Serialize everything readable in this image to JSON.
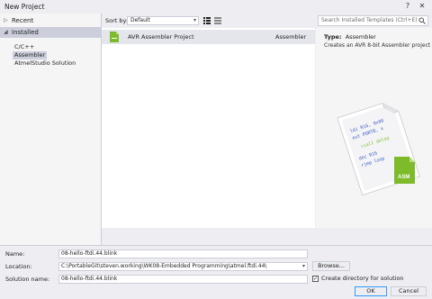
{
  "window": {
    "title": "New Project",
    "help_label": "?",
    "close_label": "✕"
  },
  "sidebar": {
    "recent_label": "Recent",
    "installed_label": "Installed",
    "items": [
      {
        "label": "C/C++"
      },
      {
        "label": "Assembler"
      },
      {
        "label": "AtmelStudio Solution"
      }
    ]
  },
  "toolbar": {
    "sort_label": "Sort by:",
    "sort_value": "Default"
  },
  "templates": [
    {
      "name": "AVR Assembler Project",
      "language": "Assembler"
    }
  ],
  "search": {
    "placeholder": "Search Installed Templates (Ctrl+E)"
  },
  "details": {
    "type_label": "Type:",
    "type_value": "Assembler",
    "description": "Creates an AVR 8-bit Assembler project"
  },
  "preview": {
    "code_lines": [
      "ldi R16, 0x00",
      "out PORTB, x",
      "rcall delay",
      "dec R16",
      "rjmp loop"
    ],
    "badge": "ASM"
  },
  "form": {
    "name_label": "Name:",
    "name_value": "08-hello-ftdi.44.blink",
    "location_label": "Location:",
    "location_value": "C:\\PortableGit\\steven.working\\WK08-Embedded Programming\\atmel.ftdi.44\\",
    "solution_label": "Solution name:",
    "solution_value": "08-hello-ftdi.44.blink",
    "browse_label": "Browse...",
    "create_dir_label": "Create directory for solution",
    "create_dir_checked": true,
    "ok_label": "OK",
    "cancel_label": "Cancel"
  },
  "colors": {
    "accent": "#3399ff",
    "selection": "#cccedb",
    "chrome": "#eeeef2",
    "asm_green": "#7dbb2a"
  }
}
